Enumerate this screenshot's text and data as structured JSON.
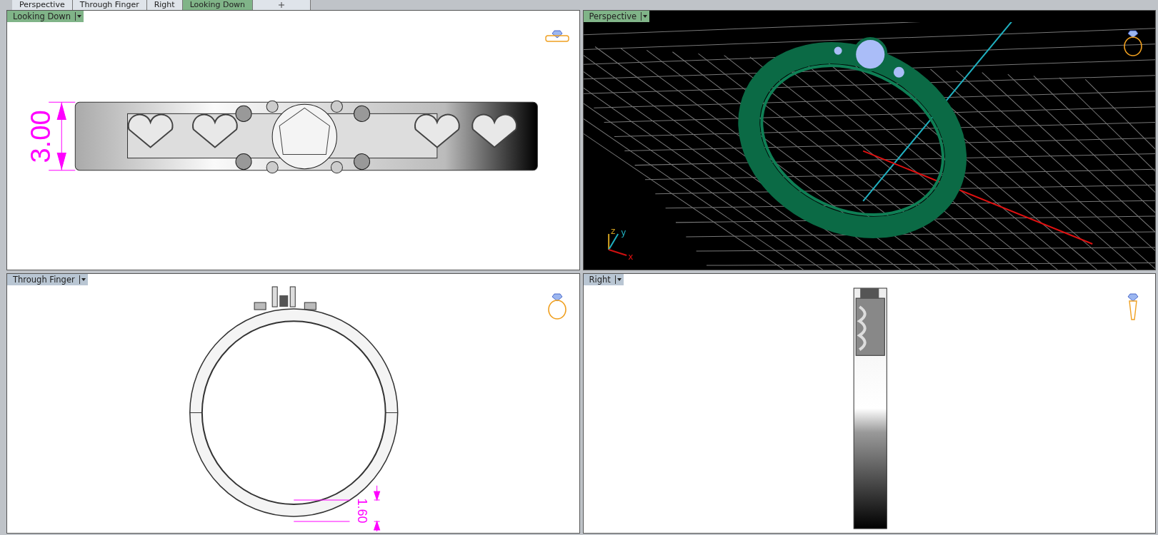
{
  "tabs": [
    {
      "label": "Perspective",
      "selected": false
    },
    {
      "label": "Through Finger",
      "selected": false
    },
    {
      "label": "Right",
      "selected": false
    },
    {
      "label": "Looking Down",
      "selected": true
    }
  ],
  "viewports": [
    {
      "kind": "top",
      "title": "Looking Down",
      "highlighted": true,
      "dimension": "3.00"
    },
    {
      "kind": "perspective",
      "title": "Perspective",
      "highlighted": true,
      "axes": [
        "z",
        "y",
        "x"
      ]
    },
    {
      "kind": "front",
      "title": "Through Finger",
      "highlighted": false,
      "dimension": "1.60"
    },
    {
      "kind": "side",
      "title": "Right",
      "highlighted": false
    }
  ]
}
